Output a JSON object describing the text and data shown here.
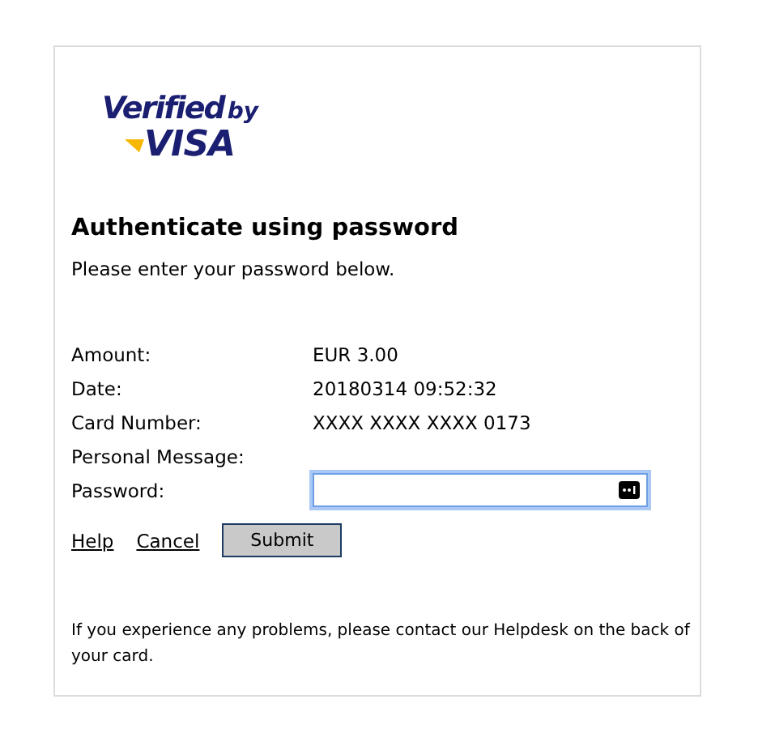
{
  "logo": {
    "line_1": "Verified",
    "line_2": "by",
    "line_3": "VISA"
  },
  "heading": "Authenticate using password",
  "instruction": "Please enter your password below.",
  "details": [
    {
      "label": "Amount:",
      "value": "EUR 3.00"
    },
    {
      "label": "Date:",
      "value": "20180314 09:52:32"
    },
    {
      "label": "Card Number:",
      "value": "XXXX XXXX XXXX 0173"
    },
    {
      "label": "Personal Message:"
    }
  ],
  "password": {
    "label": "Password:",
    "focused": true
  },
  "links": [
    "Help",
    "Cancel"
  ],
  "submit": "Submit",
  "footer": "If you experience any problems, please contact our Helpdesk on the back of your card."
}
